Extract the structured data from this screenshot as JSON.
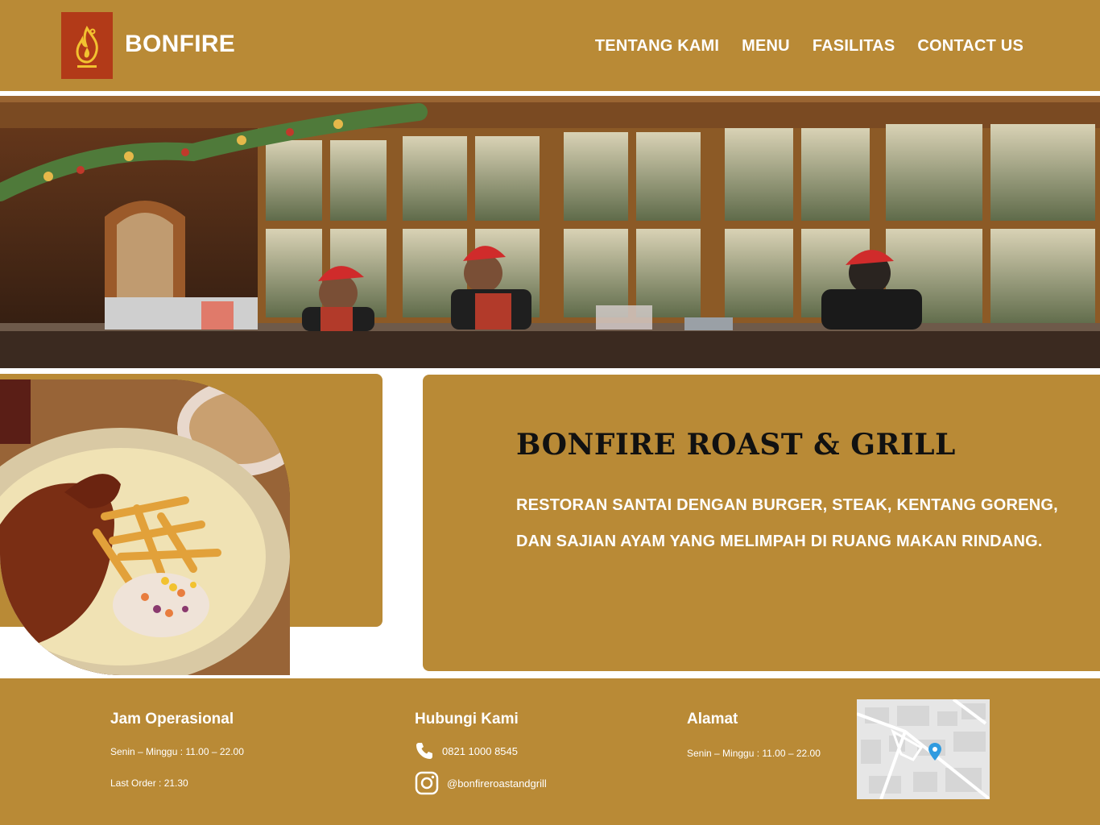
{
  "header": {
    "brand": "BONFIRE",
    "logo_icon": "flame-icon",
    "nav": [
      {
        "label": "TENTANG KAMI"
      },
      {
        "label": "MENU"
      },
      {
        "label": "FASILITAS"
      },
      {
        "label": "CONTACT US"
      }
    ]
  },
  "hero": {
    "image": "restaurant-interior-photo"
  },
  "intro": {
    "title": "BONFIRE ROAST & GRILL",
    "description": "RESTORAN SANTAI DENGAN BURGER, STEAK, KENTANG GORENG, DAN SAJIAN AYAM YANG MELIMPAH DI RUANG MAKAN RINDANG.",
    "food_image": "roast-chicken-fries-photo"
  },
  "footer": {
    "hours": {
      "heading": "Jam Operasional",
      "line1": "Senin – Minggu : 11.00 – 22.00",
      "line2": "Last Order : 21.30"
    },
    "contact": {
      "heading": "Hubungi Kami",
      "phone": "0821 1000 8545",
      "instagram": "@bonfireroastandgrill"
    },
    "address": {
      "heading": "Alamat",
      "line1": "Senin – Minggu : 11.00 – 22.00"
    },
    "map_icon": "map-pin-icon"
  },
  "colors": {
    "brand_gold": "#B98A36",
    "logo_red": "#B23A18",
    "map_pin": "#2F9BE0"
  }
}
